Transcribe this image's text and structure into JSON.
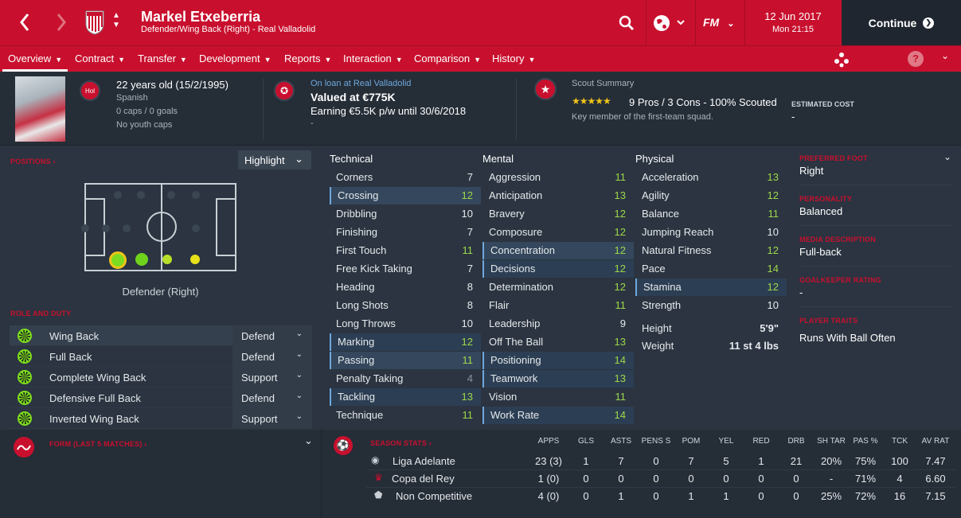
{
  "header": {
    "player_name": "Markel Etxeberria",
    "player_subtitle": "Defender/Wing Back (Right) - Real Valladolid",
    "date": "12 Jun 2017",
    "time": "Mon 21:15",
    "continue_label": "Continue",
    "fm_label": "FM"
  },
  "tabs": [
    {
      "label": "Overview"
    },
    {
      "label": "Contract"
    },
    {
      "label": "Transfer"
    },
    {
      "label": "Development"
    },
    {
      "label": "Reports"
    },
    {
      "label": "Interaction"
    },
    {
      "label": "Comparison"
    },
    {
      "label": "History"
    }
  ],
  "info": {
    "age": "22 years old (15/2/1995)",
    "nationality": "Spanish",
    "caps": "0 caps / 0 goals",
    "youth_caps": "No youth caps",
    "nat_badge": "Hol",
    "loan": "On loan at Real Valladolid",
    "value": "Valued at €775K",
    "earning": "Earning €5.5K p/w until 30/6/2018",
    "dash": "-",
    "scout_title": "Scout Summary",
    "scout_stars": "★★★★★",
    "scout_line": "9 Pros / 3 Cons - 100% Scouted",
    "scout_desc": "Key member of the first-team squad.",
    "est_cost_label": "ESTIMATED COST",
    "est_cost": "-"
  },
  "positions": {
    "label": "POSITIONS",
    "highlight": "Highlight",
    "position_name": "Defender (Right)"
  },
  "roles": {
    "label": "ROLE AND DUTY",
    "items": [
      {
        "name": "Wing Back",
        "duty": "Defend"
      },
      {
        "name": "Full Back",
        "duty": "Defend"
      },
      {
        "name": "Complete Wing Back",
        "duty": "Support"
      },
      {
        "name": "Defensive Full Back",
        "duty": "Defend"
      },
      {
        "name": "Inverted Wing Back",
        "duty": "Support"
      }
    ]
  },
  "technical": {
    "title": "Technical",
    "items": [
      {
        "n": "Corners",
        "v": "7"
      },
      {
        "n": "Crossing",
        "v": "12"
      },
      {
        "n": "Dribbling",
        "v": "10"
      },
      {
        "n": "Finishing",
        "v": "7"
      },
      {
        "n": "First Touch",
        "v": "11"
      },
      {
        "n": "Free Kick Taking",
        "v": "7"
      },
      {
        "n": "Heading",
        "v": "8"
      },
      {
        "n": "Long Shots",
        "v": "8"
      },
      {
        "n": "Long Throws",
        "v": "10"
      },
      {
        "n": "Marking",
        "v": "12"
      },
      {
        "n": "Passing",
        "v": "11"
      },
      {
        "n": "Penalty Taking",
        "v": "4"
      },
      {
        "n": "Tackling",
        "v": "13"
      },
      {
        "n": "Technique",
        "v": "11"
      }
    ]
  },
  "mental": {
    "title": "Mental",
    "items": [
      {
        "n": "Aggression",
        "v": "11"
      },
      {
        "n": "Anticipation",
        "v": "13"
      },
      {
        "n": "Bravery",
        "v": "12"
      },
      {
        "n": "Composure",
        "v": "12"
      },
      {
        "n": "Concentration",
        "v": "12"
      },
      {
        "n": "Decisions",
        "v": "12"
      },
      {
        "n": "Determination",
        "v": "12"
      },
      {
        "n": "Flair",
        "v": "11"
      },
      {
        "n": "Leadership",
        "v": "9"
      },
      {
        "n": "Off The Ball",
        "v": "13"
      },
      {
        "n": "Positioning",
        "v": "14"
      },
      {
        "n": "Teamwork",
        "v": "13"
      },
      {
        "n": "Vision",
        "v": "11"
      },
      {
        "n": "Work Rate",
        "v": "14"
      }
    ]
  },
  "physical": {
    "title": "Physical",
    "items": [
      {
        "n": "Acceleration",
        "v": "13"
      },
      {
        "n": "Agility",
        "v": "12"
      },
      {
        "n": "Balance",
        "v": "11"
      },
      {
        "n": "Jumping Reach",
        "v": "10"
      },
      {
        "n": "Natural Fitness",
        "v": "12"
      },
      {
        "n": "Pace",
        "v": "14"
      },
      {
        "n": "Stamina",
        "v": "12"
      },
      {
        "n": "Strength",
        "v": "10"
      }
    ],
    "height_label": "Height",
    "height": "5'9\"",
    "weight_label": "Weight",
    "weight": "11 st 4 lbs"
  },
  "side": {
    "foot_label": "PREFERRED FOOT",
    "foot": "Right",
    "personality_label": "PERSONALITY",
    "personality": "Balanced",
    "media_label": "MEDIA DESCRIPTION",
    "media": "Full-back",
    "gk_label": "GOALKEEPER RATING",
    "gk": "-",
    "traits_label": "PLAYER TRAITS",
    "traits": "Runs With Ball Often"
  },
  "form": {
    "label": "FORM (LAST 5 MATCHES)"
  },
  "season": {
    "label": "SEASON STATS",
    "headers": [
      "APPS",
      "GLS",
      "ASTS",
      "PENS S",
      "POM",
      "YEL",
      "RED",
      "DRB",
      "SH TAR",
      "PAS %",
      "TCK",
      "AV RAT"
    ],
    "rows": [
      {
        "comp": "Liga Adelante",
        "vals": [
          "23 (3)",
          "1",
          "7",
          "0",
          "7",
          "5",
          "1",
          "21",
          "20%",
          "75%",
          "100",
          "7.47"
        ]
      },
      {
        "comp": "Copa del Rey",
        "vals": [
          "1 (0)",
          "0",
          "0",
          "0",
          "0",
          "0",
          "0",
          "0",
          "-",
          "71%",
          "4",
          "6.60"
        ]
      },
      {
        "comp": "Non Competitive",
        "vals": [
          "4 (0)",
          "0",
          "1",
          "0",
          "1",
          "1",
          "0",
          "0",
          "25%",
          "72%",
          "16",
          "7.15"
        ]
      }
    ]
  },
  "colors": {
    "brand": "#c8102e",
    "attr_green": "#9dd84b",
    "link": "#6fa8dc"
  }
}
